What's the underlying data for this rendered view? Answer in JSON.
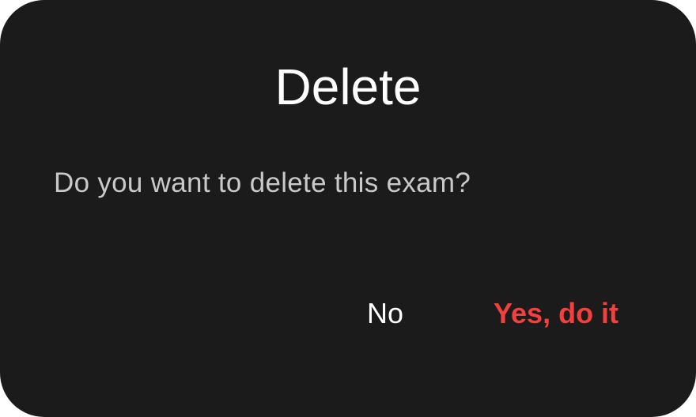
{
  "dialog": {
    "title": "Delete",
    "message": "Do you want to delete this exam?",
    "cancel_label": "No",
    "confirm_label": "Yes, do it"
  },
  "colors": {
    "background": "#1b1b1b",
    "title_text": "#ffffff",
    "message_text": "#c9c9c9",
    "confirm_accent": "#f2413d"
  }
}
